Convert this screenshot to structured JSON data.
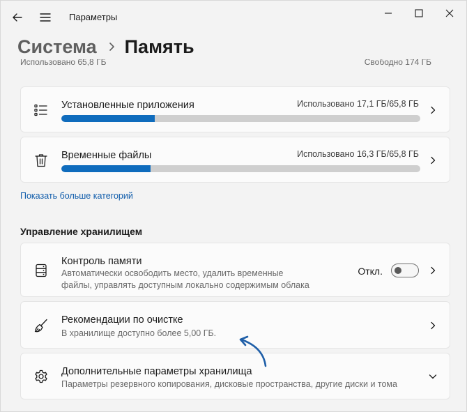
{
  "window": {
    "title": "Параметры"
  },
  "breadcrumb": {
    "parent": "Система",
    "current": "Память"
  },
  "clipped_row": {
    "left": "Использовано 65,8 ГБ",
    "right": "Свободно 174 ГБ"
  },
  "categories": [
    {
      "title": "Установленные приложения",
      "usage": "Использовано 17,1 ГБ/65,8 ГБ",
      "fill": 0.26,
      "icon": "list-icon"
    },
    {
      "title": "Временные файлы",
      "usage": "Использовано 16,3 ГБ/65,8 ГБ",
      "fill": 0.248,
      "icon": "trash-icon"
    }
  ],
  "show_more_link": "Показать больше категорий",
  "management": {
    "section_title": "Управление хранилищем",
    "items": [
      {
        "title": "Контроль памяти",
        "desc_line1": "Автоматически освободить место, удалить временные",
        "desc_line2": "файлы, управлять доступным локально содержимым облака",
        "toggle_label": "Откл.",
        "toggle_on": false,
        "icon": "storage-sense-icon"
      },
      {
        "title": "Рекомендации по очистке",
        "desc": "В хранилище доступно более 5,00 ГБ.",
        "icon": "broom-icon"
      },
      {
        "title": "Дополнительные параметры хранилища",
        "desc": "Параметры резервного копирования, дисковые пространства, другие диски и тома",
        "icon": "gear-icon"
      }
    ]
  },
  "colors": {
    "accent": "#0f6cbd",
    "annotation_arrow": "#1f5fa8",
    "background": "#f3f3f3",
    "card": "#fbfbfb"
  }
}
